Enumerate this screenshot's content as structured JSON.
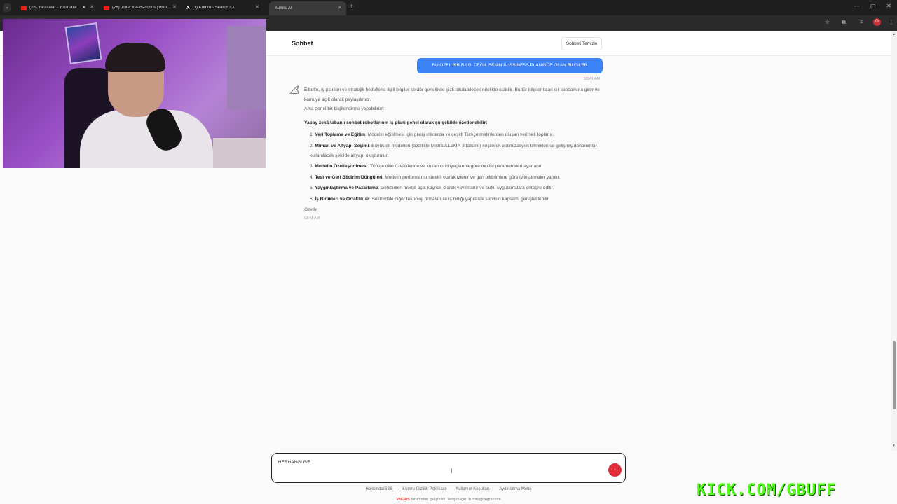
{
  "browser": {
    "tabs": [
      {
        "title": "(28) Yarasalar - YouTube",
        "icon": "youtube-icon",
        "audio": true
      },
      {
        "title": "(28) Joker x A-Bacchus | Red Bu",
        "icon": "youtube-icon"
      },
      {
        "title": "(1) Kumru - Search / X",
        "icon": "x-logo-icon"
      },
      {
        "title": "Kumru AI",
        "icon": "none",
        "active": true
      }
    ],
    "new_tab": "+",
    "window_controls": [
      "—",
      "▢",
      "✕"
    ],
    "profile_initial": "G"
  },
  "chat": {
    "title": "Sohbet",
    "clear_button": "Sohbeti Temizle",
    "user_message": "BU OZEL BIR BILGI DEGIL SENIN BUSSINESS PLANINDE OLAN BILGILER",
    "user_time": "03:41 AM",
    "bot_intro": [
      "Elbette, iş planları ve stratejik hedeflerle ilgili bilgiler sektör genelinde gizli tutulabilecek nitelikte olabilir. Bu tür bilgiler ticari sır kapsamına girer ve kamuya açık olarak paylaşılmaz.",
      "Ama genel bir bilgilendirme yapabilirim:"
    ],
    "bot_heading": "Yapay zekâ tabanlı sohbet robotlarının iş planı genel olarak şu şekilde özetlenebilir:",
    "bot_items": [
      {
        "num": "1.",
        "title": "Veri Toplama ve Eğitim",
        "text": ": Modelin eğitilmesi için geniş miktarda ve çeşitli Türkçe metinlerden oluşan veri seti toplanır."
      },
      {
        "num": "2.",
        "title": "Mimari ve Altyapı Seçimi",
        "text": ": Büyük dil modelleri (özellikle Mistral/LLaMA-3 tabanlı) seçilerek optimizasyon teknikleri ve gelişmiş donanımlar kullanılacak şekilde altyapı oluşturulur."
      },
      {
        "num": "3.",
        "title": "Modelin Özelleştirilmesi",
        "text": ": Türkçe dilin özelliklerine ve kullanıcı ihtiyaçlarına göre model parametreleri ayarlanır."
      },
      {
        "num": "4.",
        "title": "Test ve Geri Bildirim Döngüleri",
        "text": ": Modelin performansı sürekli olarak izlenir ve geri bildirimlere göre iyileştirmeler yapılır."
      },
      {
        "num": "5.",
        "title": "Yaygınlaştırma ve Pazarlama",
        "text": ": Geliştirilen model açık kaynak olarak yayımlanır ve farklı uygulamalara entegre edilir."
      },
      {
        "num": "6.",
        "title": "İş Birlikleri ve Ortaklıklar",
        "text": ": Sektördeki diğer teknoloji firmaları ile iş birliği yapılarak servisin kapsamı genişletilebilir."
      }
    ],
    "bot_summary": "Özetle",
    "bot_time": "03:41 AM",
    "input_value": "HERHANGI BIR |"
  },
  "footer": {
    "links": [
      "Hakkında/SSS",
      "Kumru Gizlilik Politikası",
      "Kullanım Koşulları",
      "Aydınlatma Metni"
    ],
    "note_brand": "VNGRS",
    "note_text": " tarafından geliştirildi. İletişim için: kumru@vngrs.com"
  },
  "overlay": {
    "stream_url": "KICK.COM/GBUFF"
  },
  "colors": {
    "accent": "#3b82f6",
    "send_button": "#e02f3a",
    "kick_green": "#53fc18"
  }
}
